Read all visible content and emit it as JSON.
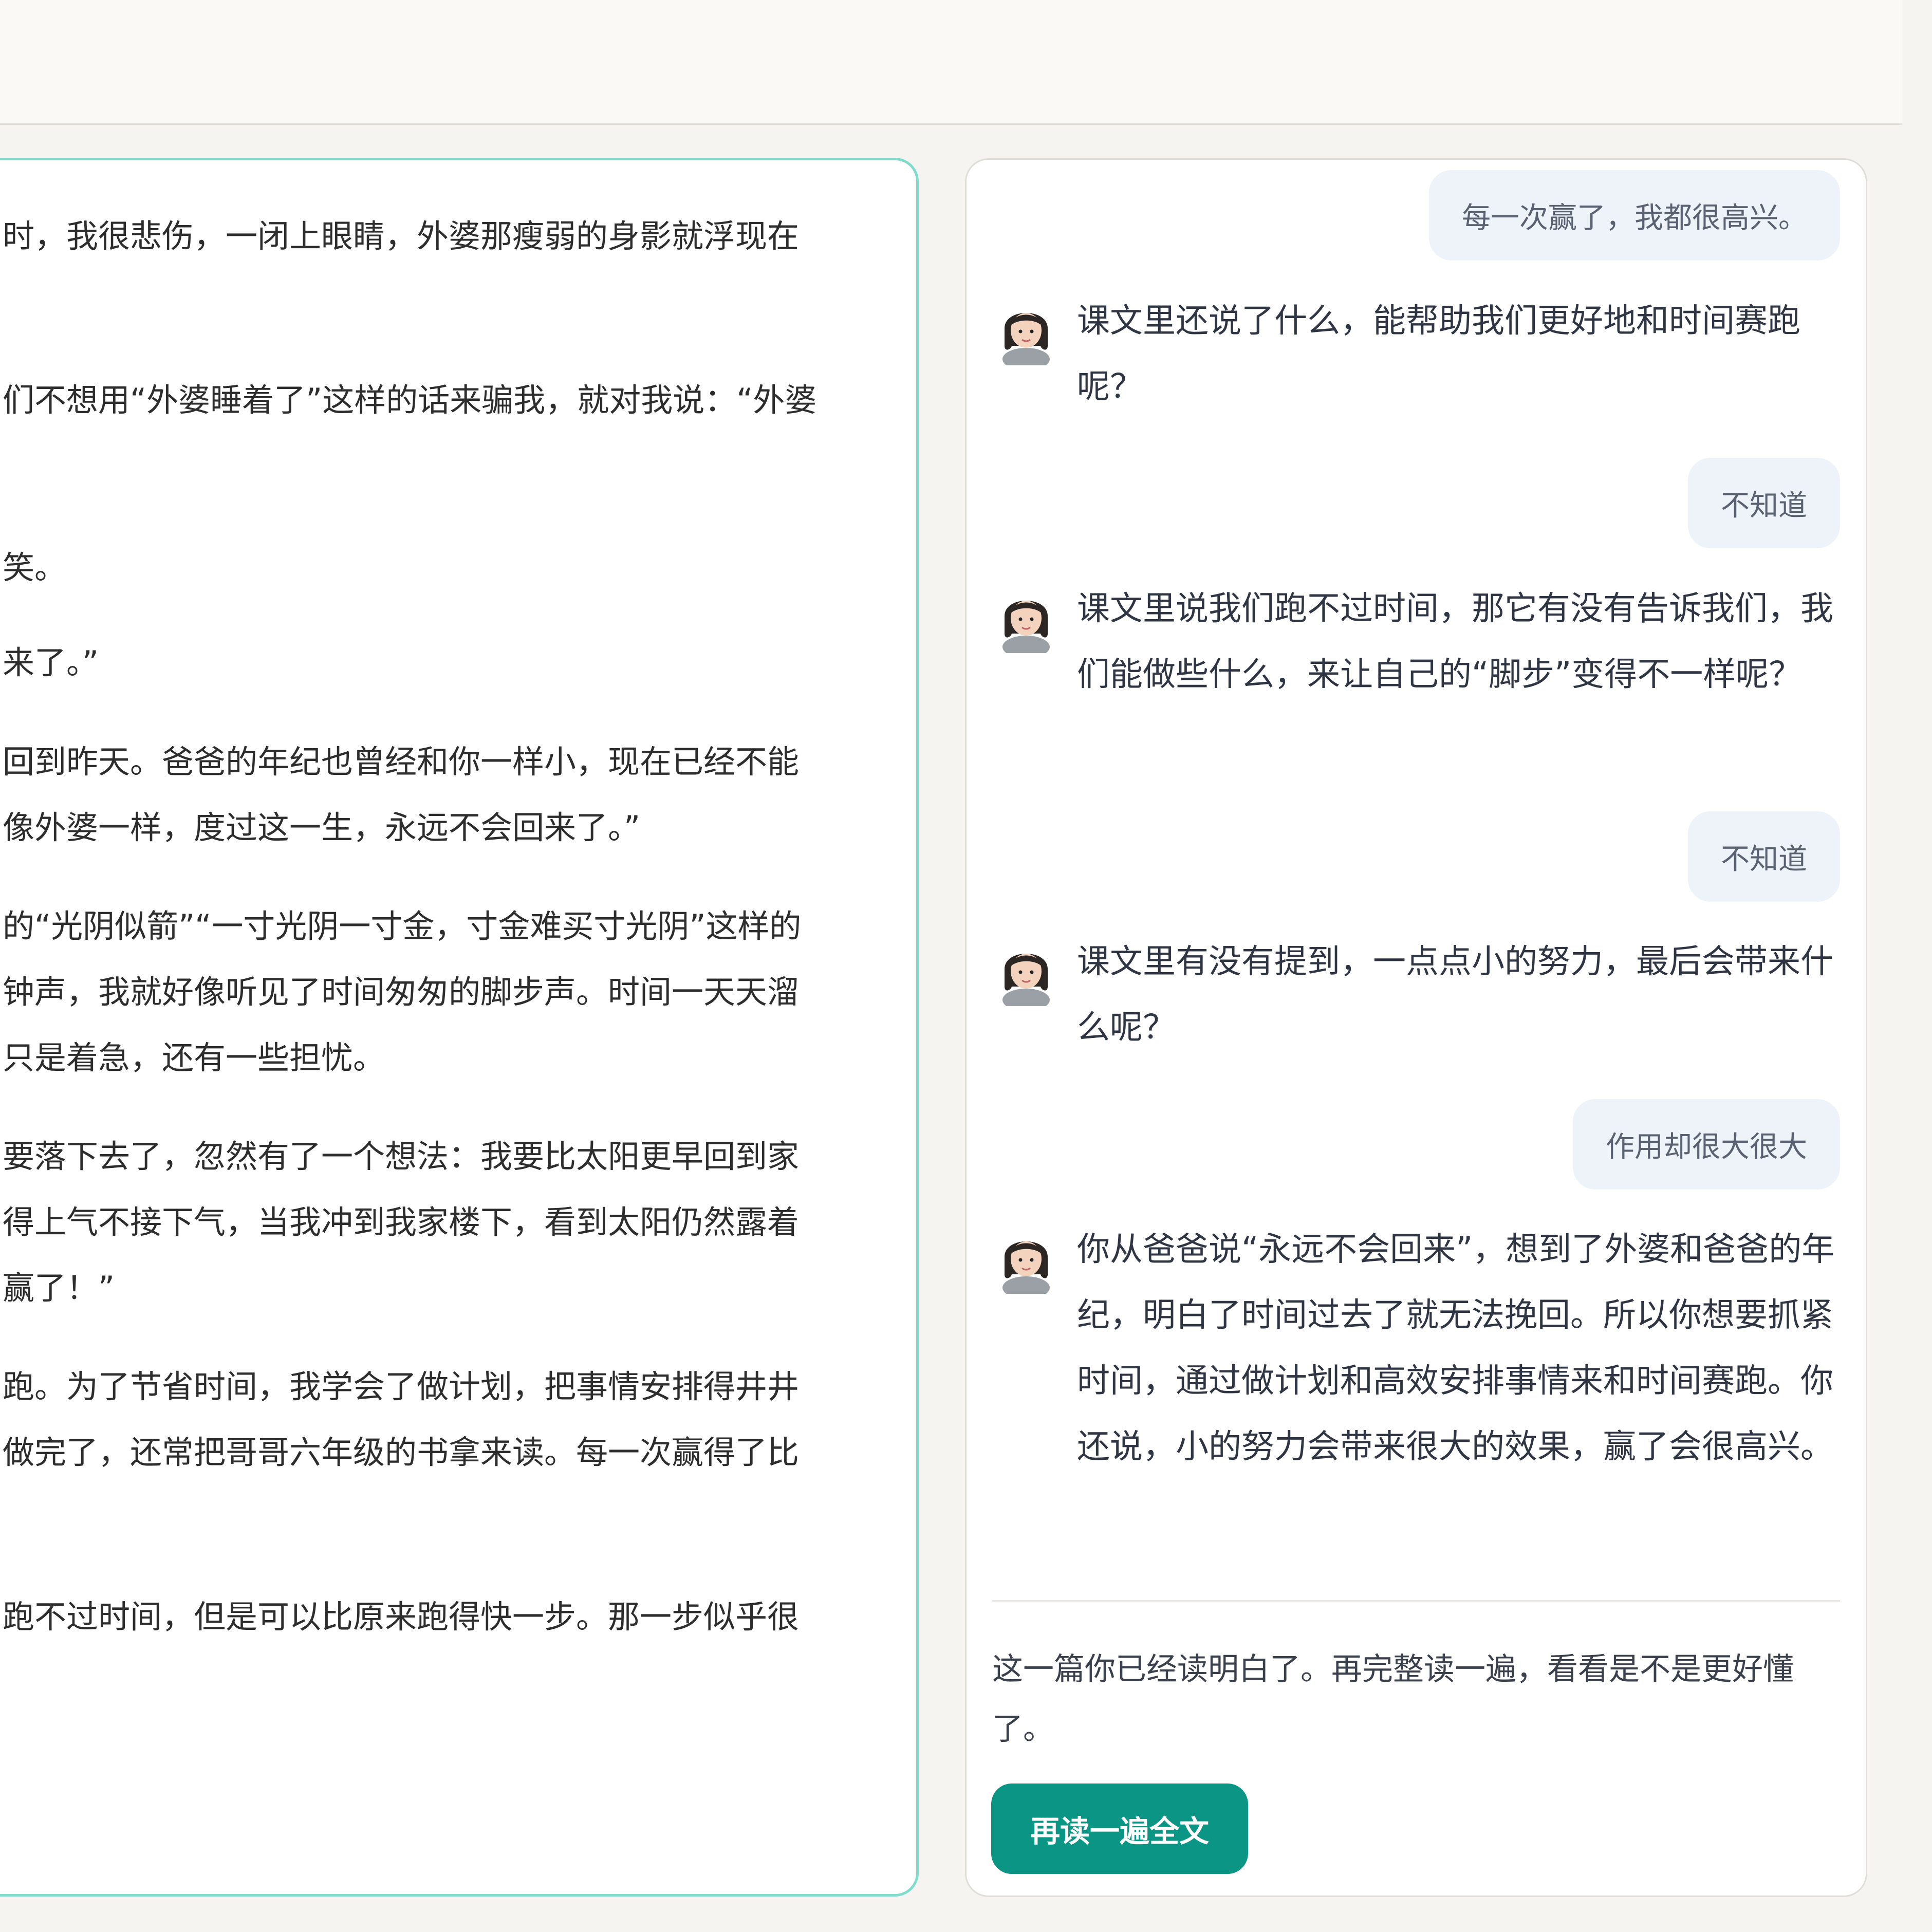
{
  "reader": {
    "lines": [
      "时，我很悲伤，一闭上眼睛，外婆那瘦弱的身影就浮现在",
      "们不想用“外婆睡着了”这样的话来骗我，就对我说：“外婆",
      "笑。",
      "来了。”",
      "回到昨天。爸爸的年纪也曾经和你一样小，现在已经不能",
      "像外婆一样，度过这一生，永远不会回来了。”",
      "的“光阴似箭”“一寸光阴一寸金，寸金难买寸光阴”这样的",
      "钟声，我就好像听见了时间匆匆的脚步声。时间一天天溜",
      "只是着急，还有一些担忧。",
      "要落下去了，忽然有了一个想法：我要比太阳更早回到家",
      "得上气不接下气，当我冲到我家楼下，看到太阳仍然露着",
      "赢了！”",
      "跑。为了节省时间，我学会了做计划，把事情安排得井井",
      "做完了，还常把哥哥六年级的书拿来读。每一次赢得了比",
      "跑不过时间，但是可以比原来跑得快一步。那一步似乎很"
    ]
  },
  "chat": {
    "messages": [
      {
        "role": "user",
        "text": "每一次赢了，我都很高兴。"
      },
      {
        "role": "bot",
        "text": "课文里还说了什么，能帮助我们更好地和时间赛跑呢？"
      },
      {
        "role": "user",
        "text": "不知道"
      },
      {
        "role": "bot",
        "text": "课文里说我们跑不过时间，那它有没有告诉我们，我们能做些什么，来让自己的“脚步”变得不一样呢？"
      },
      {
        "role": "user",
        "text": "不知道"
      },
      {
        "role": "bot",
        "text": "课文里有没有提到，一点点小的努力，最后会带来什么呢？"
      },
      {
        "role": "user",
        "text": "作用却很大很大"
      },
      {
        "role": "bot",
        "text": "你从爸爸说“永远不会回来”，想到了外婆和爸爸的年纪，明白了时间过去了就无法挽回。所以你想要抓紧时间，通过做计划和高效安排事情来和时间赛跑。你还说，小的努力会带来很大的效果，赢了会很高兴。"
      }
    ],
    "summary": "这一篇你已经读明白了。再完整读一遍，看看是不是更好懂了。",
    "reread_button": "再读一遍全文",
    "avatar_icon": "teacher-avatar-icon"
  },
  "colors": {
    "accent": "#0b9584",
    "reader_border": "#7fdccd",
    "user_bubble": "#eef2f9",
    "background": "#f6f4f0"
  }
}
